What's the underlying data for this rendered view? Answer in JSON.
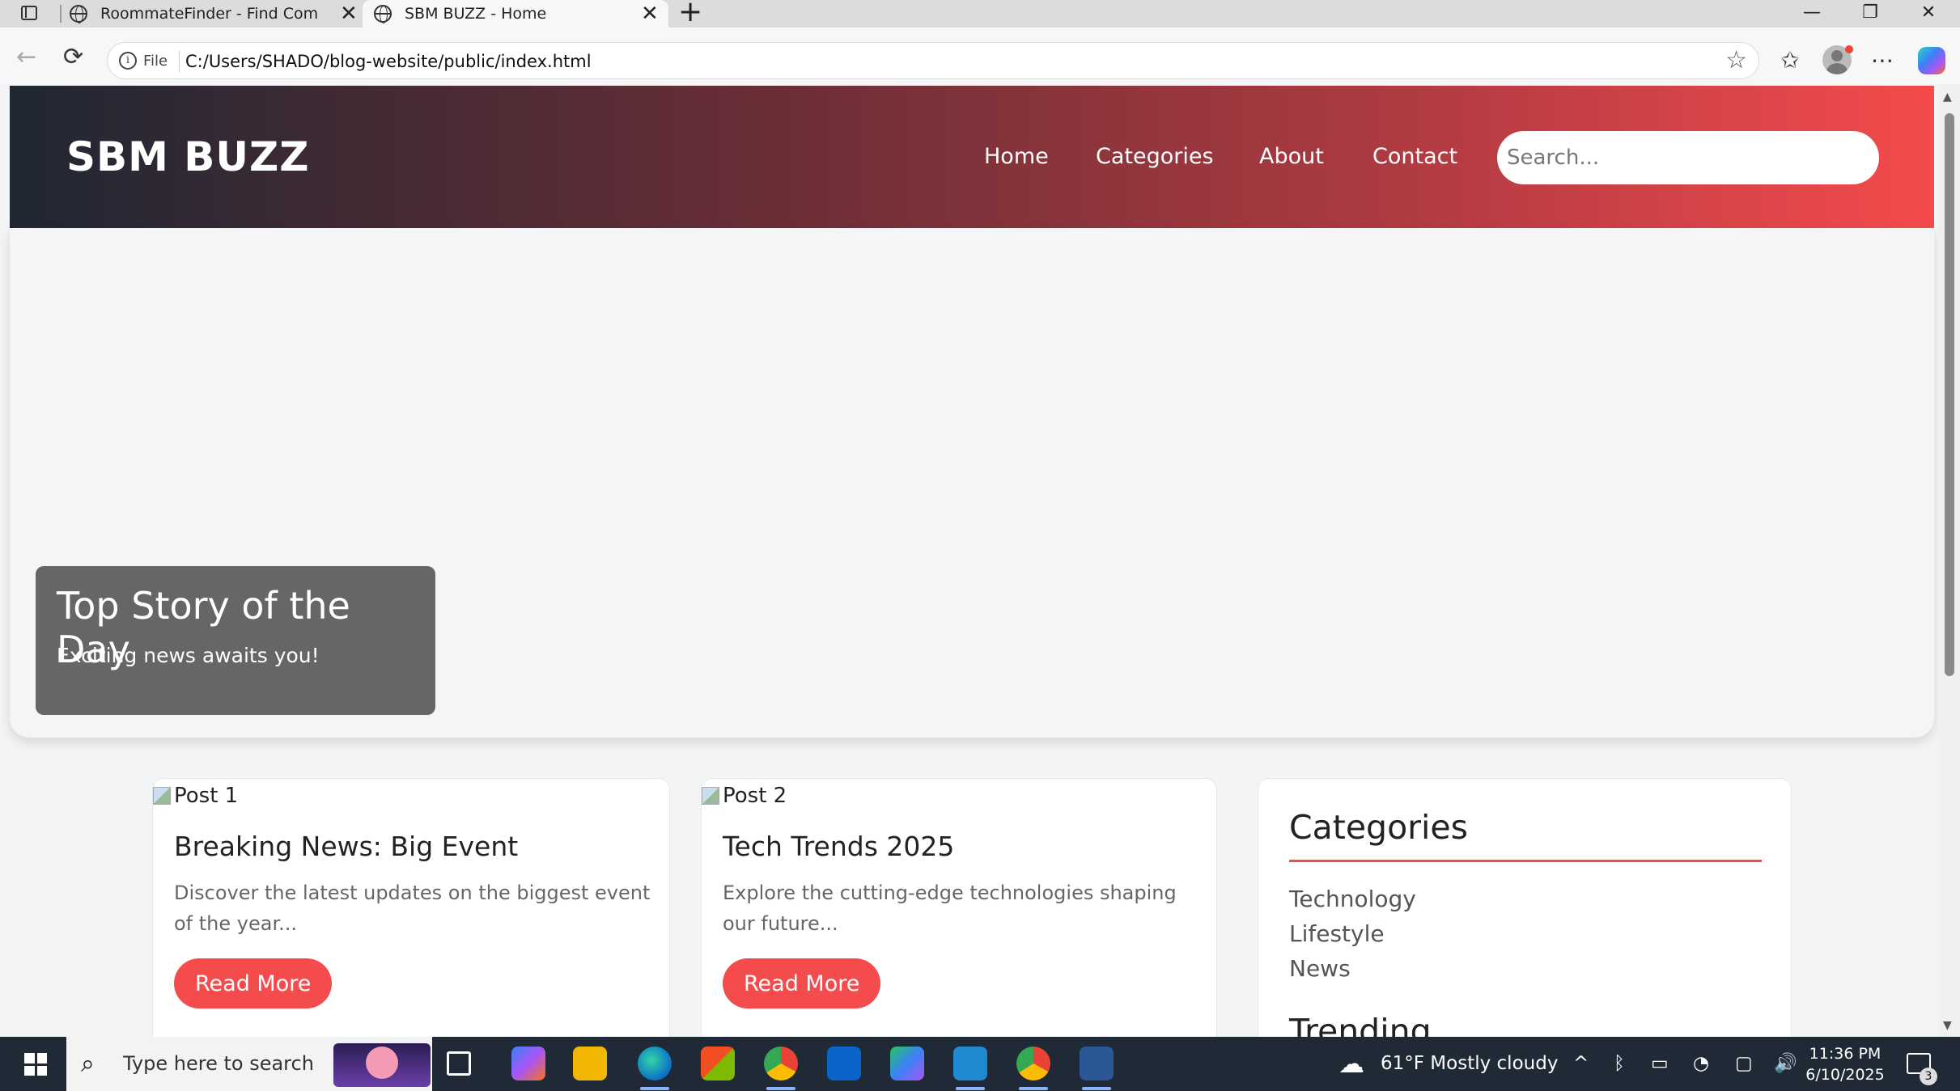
{
  "browser": {
    "tabs": [
      {
        "title": "RoommateFinder - Find Compatil",
        "close": "✕"
      },
      {
        "title": "SBM BUZZ - Home",
        "close": "✕"
      }
    ],
    "new_tab": "+",
    "window": {
      "minimize": "—",
      "maximize": "❐",
      "close": "✕"
    },
    "address": {
      "scheme_label": "File",
      "url": "C:/Users/SHADO/blog-website/public/index.html"
    }
  },
  "site": {
    "logo": "SBM BUZZ",
    "nav": [
      "Home",
      "Categories",
      "About",
      "Contact"
    ],
    "search_placeholder": "Search..."
  },
  "hero": {
    "title": "Top Story of the Day",
    "subtitle": "Exciting news awaits you!"
  },
  "posts": [
    {
      "img_alt": "Post 1",
      "title": "Breaking News: Big Event",
      "excerpt": "Discover the latest updates on the biggest event of the year...",
      "button": "Read More"
    },
    {
      "img_alt": "Post 2",
      "title": "Tech Trends 2025",
      "excerpt": "Explore the cutting-edge technologies shaping our future...",
      "button": "Read More"
    }
  ],
  "sidebar": {
    "categories_title": "Categories",
    "categories": [
      "Technology",
      "Lifestyle",
      "News"
    ],
    "trending_title": "Trending"
  },
  "taskbar": {
    "search_placeholder": "Type here to search",
    "weather": "61°F  Mostly cloudy",
    "time": "11:36 PM",
    "date": "6/10/2025",
    "notifications": "3"
  },
  "colors": {
    "accent": "#f44b4c",
    "header_start": "#1f2733",
    "header_end": "#f44b4c"
  }
}
